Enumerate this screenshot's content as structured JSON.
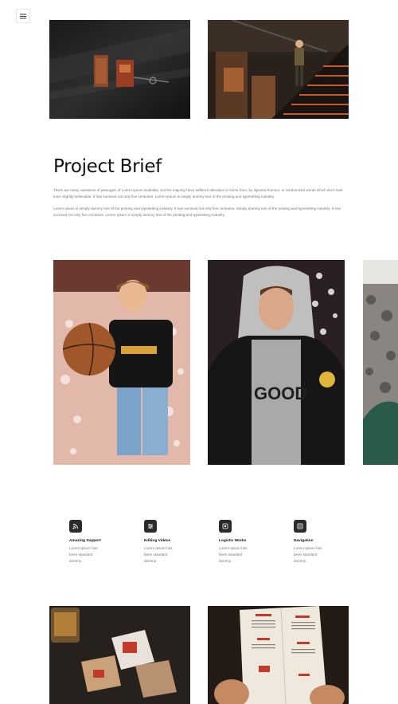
{
  "header": {
    "menu_icon": "hamburger-menu-icon"
  },
  "gallery_top": [
    {
      "alt": "Dark wall with hanging tags and key"
    },
    {
      "alt": "Person walking down industrial staircase"
    }
  ],
  "brief": {
    "title": "Project Brief",
    "paragraph_1": "There are many variations of passages of Lorem Ipsum available, but the majority have suffered alteration in some form, by injected humour, or randomised words which don't look even slightly believable. It has survived not only five centuries. Lorem Ipsum is simply dummy text of the printing and typesetting industry.",
    "paragraph_2": "Lorem Ipsum is simply dummy text of the printing and typesetting industry. It has survived not only five centuries. Simply dummy text of the printing and typesetting industry. It has survived not only five centuries. Lorem Ipsum is simply dummy text of the printing and typesetting industry."
  },
  "carousel": [
    {
      "alt": "Young man holding basketball"
    },
    {
      "alt": "Young man in grey hoodie and black jacket"
    },
    {
      "alt": "Partially visible portrait"
    }
  ],
  "features": [
    {
      "icon": "rss-icon",
      "title": "Amazing Support",
      "desc": "Lorem Ipsum has been standard dummy."
    },
    {
      "icon": "sliders-icon",
      "title": "Editing Videos",
      "desc": "Lorem Ipsum has been standard dummy."
    },
    {
      "icon": "target-icon",
      "title": "Logistic Works",
      "desc": "Lorem Ipsum has been standard dummy."
    },
    {
      "icon": "list-icon",
      "title": "Navigation",
      "desc": "Lorem Ipsum has been standard dummy."
    }
  ],
  "gallery_bottom": [
    {
      "alt": "Drink glass and coasters on dark table"
    },
    {
      "alt": "Hands holding a restaurant menu"
    }
  ]
}
